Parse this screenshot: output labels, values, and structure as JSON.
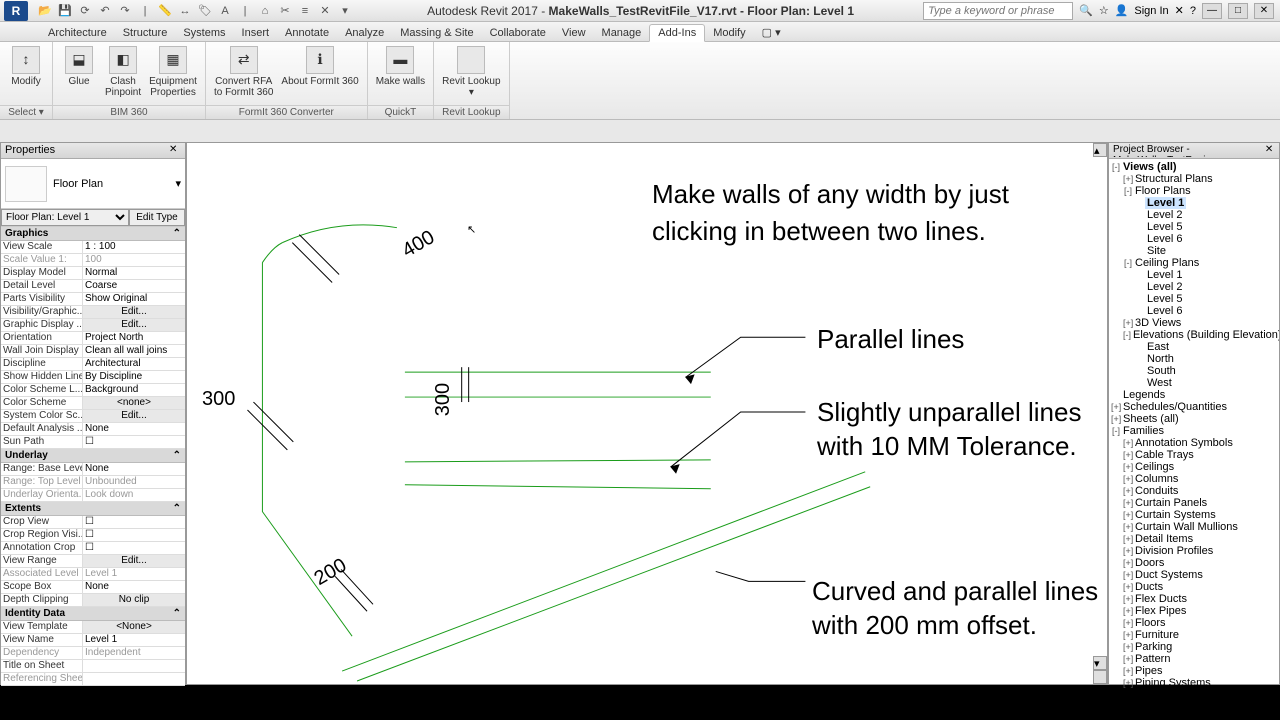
{
  "titlebar": {
    "app_title": "Autodesk Revit 2017 -",
    "doc_title": "MakeWalls_TestRevitFile_V17.rvt - Floor Plan: Level 1",
    "search_placeholder": "Type a keyword or phrase",
    "sign_in": "Sign In"
  },
  "tabs": [
    "Architecture",
    "Structure",
    "Systems",
    "Insert",
    "Annotate",
    "Analyze",
    "Massing & Site",
    "Collaborate",
    "View",
    "Manage",
    "Add-Ins",
    "Modify"
  ],
  "active_tab": "Add-Ins",
  "ribbon": {
    "groups": [
      {
        "label": "Select ▾",
        "buttons": [
          {
            "label": "Modify",
            "icon": "↕"
          }
        ]
      },
      {
        "label": "BIM 360",
        "buttons": [
          {
            "label": "Glue",
            "icon": "⬓"
          },
          {
            "label": "Clash\nPinpoint",
            "icon": "◧"
          },
          {
            "label": "Equipment\nProperties",
            "icon": "▦"
          }
        ]
      },
      {
        "label": "FormIt 360 Converter",
        "buttons": [
          {
            "label": "Convert RFA\nto FormIt 360",
            "icon": "⇄"
          },
          {
            "label": "About FormIt 360",
            "icon": "ℹ"
          }
        ]
      },
      {
        "label": "QuickT",
        "buttons": [
          {
            "label": "Make walls",
            "icon": "▬"
          }
        ]
      },
      {
        "label": "Revit Lookup",
        "buttons": [
          {
            "label": "Revit Lookup\n▾",
            "icon": ""
          }
        ]
      }
    ]
  },
  "properties": {
    "title": "Properties",
    "type_label": "Floor Plan",
    "selector": "Floor Plan: Level 1",
    "edit_type": "Edit Type",
    "sections": [
      {
        "name": "Graphics",
        "rows": [
          {
            "k": "View Scale",
            "v": "1 : 100"
          },
          {
            "k": "Scale Value   1:",
            "v": "100",
            "dim": true
          },
          {
            "k": "Display Model",
            "v": "Normal"
          },
          {
            "k": "Detail Level",
            "v": "Coarse"
          },
          {
            "k": "Parts Visibility",
            "v": "Show Original"
          },
          {
            "k": "Visibility/Graphic...",
            "v": "Edit...",
            "btn": true
          },
          {
            "k": "Graphic Display ...",
            "v": "Edit...",
            "btn": true
          },
          {
            "k": "Orientation",
            "v": "Project North"
          },
          {
            "k": "Wall Join Display",
            "v": "Clean all wall joins"
          },
          {
            "k": "Discipline",
            "v": "Architectural"
          },
          {
            "k": "Show Hidden Lines",
            "v": "By Discipline"
          },
          {
            "k": "Color Scheme L...",
            "v": "Background"
          },
          {
            "k": "Color Scheme",
            "v": "<none>",
            "btn": true
          },
          {
            "k": "System Color Sc...",
            "v": "Edit...",
            "btn": true
          },
          {
            "k": "Default Analysis ...",
            "v": "None"
          },
          {
            "k": "Sun Path",
            "v": "☐"
          }
        ]
      },
      {
        "name": "Underlay",
        "rows": [
          {
            "k": "Range: Base Level",
            "v": "None"
          },
          {
            "k": "Range: Top Level",
            "v": "Unbounded",
            "dim": true
          },
          {
            "k": "Underlay Orienta...",
            "v": "Look down",
            "dim": true
          }
        ]
      },
      {
        "name": "Extents",
        "rows": [
          {
            "k": "Crop View",
            "v": "☐"
          },
          {
            "k": "Crop Region Visi...",
            "v": "☐"
          },
          {
            "k": "Annotation Crop",
            "v": "☐"
          },
          {
            "k": "View Range",
            "v": "Edit...",
            "btn": true
          },
          {
            "k": "Associated Level",
            "v": "Level 1",
            "dim": true
          },
          {
            "k": "Scope Box",
            "v": "None"
          },
          {
            "k": "Depth Clipping",
            "v": "No clip",
            "btn": true
          }
        ]
      },
      {
        "name": "Identity Data",
        "rows": [
          {
            "k": "View Template",
            "v": "<None>",
            "btn": true
          },
          {
            "k": "View Name",
            "v": "Level 1"
          },
          {
            "k": "Dependency",
            "v": "Independent",
            "dim": true
          },
          {
            "k": "Title on Sheet",
            "v": ""
          },
          {
            "k": "Referencing Sheet",
            "v": "",
            "dim": true
          }
        ]
      }
    ]
  },
  "canvas": {
    "heading1": "Make walls of any width by just",
    "heading2": "clicking in between two lines.",
    "label_parallel": "Parallel lines",
    "label_unparallel1": "Slightly unparallel lines",
    "label_unparallel2": "with 10 MM Tolerance.",
    "label_curved1": "Curved and parallel lines",
    "label_curved2": "with 200 mm offset.",
    "dim_400": "400",
    "dim_300a": "300",
    "dim_300b": "300",
    "dim_200": "200"
  },
  "browser": {
    "title": "Project Browser - MakeWalls_TestRevi...",
    "tree": [
      {
        "l": "Views (all)",
        "d": 0,
        "t": "-",
        "bold": true
      },
      {
        "l": "Structural Plans",
        "d": 1,
        "t": "+"
      },
      {
        "l": "Floor Plans",
        "d": 1,
        "t": "-"
      },
      {
        "l": "Level 1",
        "d": 2,
        "sel": true,
        "bold": true
      },
      {
        "l": "Level 2",
        "d": 2
      },
      {
        "l": "Level 5",
        "d": 2
      },
      {
        "l": "Level 6",
        "d": 2
      },
      {
        "l": "Site",
        "d": 2
      },
      {
        "l": "Ceiling Plans",
        "d": 1,
        "t": "-"
      },
      {
        "l": "Level 1",
        "d": 2
      },
      {
        "l": "Level 2",
        "d": 2
      },
      {
        "l": "Level 5",
        "d": 2
      },
      {
        "l": "Level 6",
        "d": 2
      },
      {
        "l": "3D Views",
        "d": 1,
        "t": "+"
      },
      {
        "l": "Elevations (Building Elevation)",
        "d": 1,
        "t": "-"
      },
      {
        "l": "East",
        "d": 2
      },
      {
        "l": "North",
        "d": 2
      },
      {
        "l": "South",
        "d": 2
      },
      {
        "l": "West",
        "d": 2
      },
      {
        "l": "Legends",
        "d": 0,
        "t": ""
      },
      {
        "l": "Schedules/Quantities",
        "d": 0,
        "t": "+"
      },
      {
        "l": "Sheets (all)",
        "d": 0,
        "t": "+"
      },
      {
        "l": "Families",
        "d": 0,
        "t": "-"
      },
      {
        "l": "Annotation Symbols",
        "d": 1,
        "t": "+"
      },
      {
        "l": "Cable Trays",
        "d": 1,
        "t": "+"
      },
      {
        "l": "Ceilings",
        "d": 1,
        "t": "+"
      },
      {
        "l": "Columns",
        "d": 1,
        "t": "+"
      },
      {
        "l": "Conduits",
        "d": 1,
        "t": "+"
      },
      {
        "l": "Curtain Panels",
        "d": 1,
        "t": "+"
      },
      {
        "l": "Curtain Systems",
        "d": 1,
        "t": "+"
      },
      {
        "l": "Curtain Wall Mullions",
        "d": 1,
        "t": "+"
      },
      {
        "l": "Detail Items",
        "d": 1,
        "t": "+"
      },
      {
        "l": "Division Profiles",
        "d": 1,
        "t": "+"
      },
      {
        "l": "Doors",
        "d": 1,
        "t": "+"
      },
      {
        "l": "Duct Systems",
        "d": 1,
        "t": "+"
      },
      {
        "l": "Ducts",
        "d": 1,
        "t": "+"
      },
      {
        "l": "Flex Ducts",
        "d": 1,
        "t": "+"
      },
      {
        "l": "Flex Pipes",
        "d": 1,
        "t": "+"
      },
      {
        "l": "Floors",
        "d": 1,
        "t": "+"
      },
      {
        "l": "Furniture",
        "d": 1,
        "t": "+"
      },
      {
        "l": "Parking",
        "d": 1,
        "t": "+"
      },
      {
        "l": "Pattern",
        "d": 1,
        "t": "+"
      },
      {
        "l": "Pipes",
        "d": 1,
        "t": "+"
      },
      {
        "l": "Piping Systems",
        "d": 1,
        "t": "+"
      }
    ]
  }
}
